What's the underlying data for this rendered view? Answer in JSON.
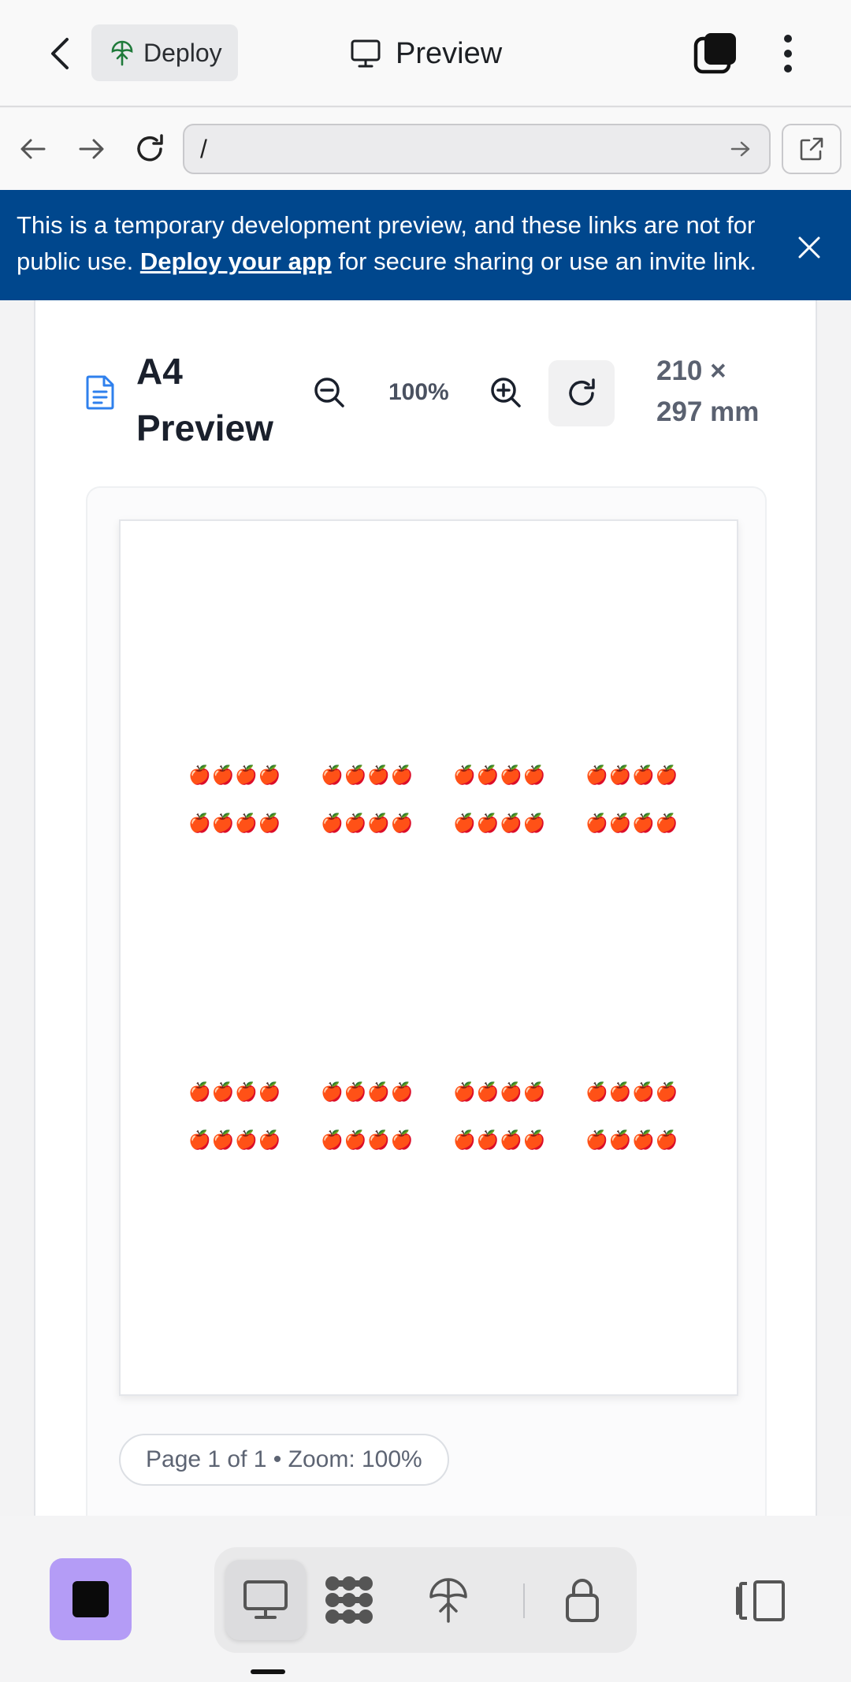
{
  "topbar": {
    "deploy_label": "Deploy",
    "title": "Preview"
  },
  "browser": {
    "url_value": "/"
  },
  "banner": {
    "text_before": "This is a temporary development preview, and these links are not for public use. ",
    "link_text": "Deploy your app",
    "text_after": " for secure sharing or use an invite link."
  },
  "preview": {
    "title": "A4 Preview",
    "zoom_level": "100%",
    "dimensions": "210 × 297 mm",
    "page_status": "Page 1 of 1 • Zoom: 100%"
  },
  "document": {
    "emoji_group": "🍎🍎🍎🍎"
  },
  "bottombar": {
    "active_tab": "desktop-preview"
  },
  "colors": {
    "banner_bg": "#00478d",
    "stop_button": "#b49cf6",
    "doc_icon": "#2f80ed"
  }
}
